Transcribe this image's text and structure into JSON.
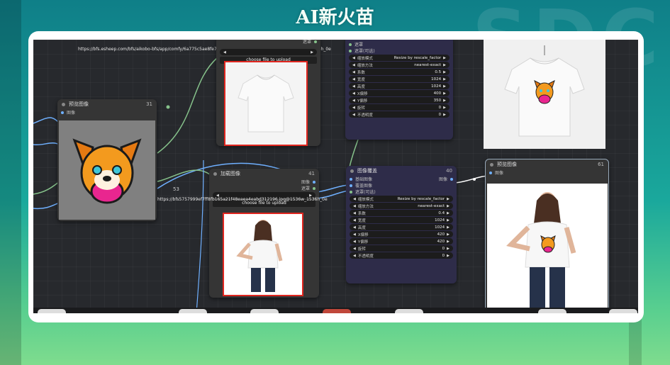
{
  "brand": {
    "title": "AI新火苗",
    "watermark": "SDC"
  },
  "colors": {
    "wire_blue": "#6fb0ff",
    "wire_green": "#86c28b",
    "accent_red": "#e0261f",
    "node_bg": "#353535"
  },
  "nodes": {
    "top_load": {
      "url": "https://bfs.esheep.com/bfs/aikobo-bfs/app/comfy/6a775c5ae8fe742803e27ab4bf17f1f286ccd8.png@1536w_1536h_0e",
      "output_label": "遮罩",
      "upload_label": "choose file to upload"
    },
    "preview_left": {
      "title": "预览图像",
      "id": "31",
      "port": "图像"
    },
    "load_image": {
      "title": "加载图像",
      "id": "41",
      "link_num": "53",
      "url": "https://bfs5757999ef7ff8fb165a21f48eaea4eabd312196.jpg@1536w_1536h_0e",
      "out_image": "图像",
      "out_mask": "遮罩",
      "upload_label": "choose file to upload"
    },
    "overlay_top": {
      "inputs": [
        "遮罩",
        "遮罩(可选)"
      ],
      "widgets": [
        {
          "label": "缩放模式",
          "value": "Resize by rescale_factor"
        },
        {
          "label": "缩放方法",
          "value": "nearest-exact"
        },
        {
          "label": "系数",
          "value": "0.5"
        },
        {
          "label": "宽度",
          "value": "1024"
        },
        {
          "label": "高度",
          "value": "1024"
        },
        {
          "label": "X偏移",
          "value": "400"
        },
        {
          "label": "Y偏移",
          "value": "350"
        },
        {
          "label": "旋转",
          "value": "0"
        },
        {
          "label": "不透明度",
          "value": "0"
        }
      ]
    },
    "overlay_bottom": {
      "title": "图像覆盖",
      "id": "40",
      "inputs": [
        "基础图像",
        "覆盖图像",
        "遮罩(可选)"
      ],
      "output": "图像",
      "widgets": [
        {
          "label": "缩放模式",
          "value": "Resize by rescale_factor"
        },
        {
          "label": "缩放方法",
          "value": "nearest-exact"
        },
        {
          "label": "系数",
          "value": "0.4"
        },
        {
          "label": "宽度",
          "value": "1024"
        },
        {
          "label": "高度",
          "value": "1024"
        },
        {
          "label": "X偏移",
          "value": "420"
        },
        {
          "label": "Y偏移",
          "value": "420"
        },
        {
          "label": "旋转",
          "value": "0"
        },
        {
          "label": "不透明度",
          "value": "0"
        }
      ]
    },
    "preview_right": {
      "title": "预览图像",
      "id": "61",
      "port": "图像"
    }
  }
}
